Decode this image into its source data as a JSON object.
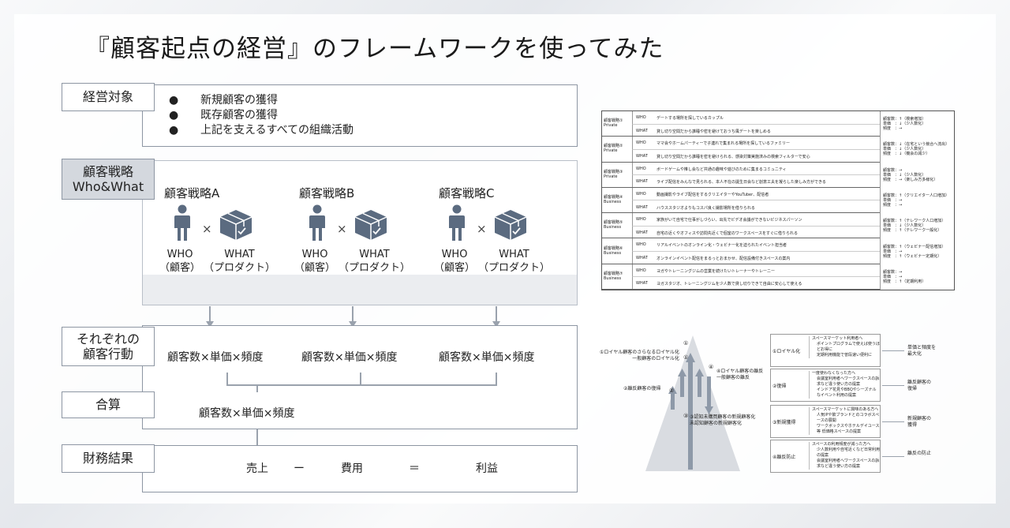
{
  "title": "『顧客起点の経営』のフレームワークを使ってみた",
  "sections": {
    "target": {
      "label": "経営対象",
      "bullets": [
        "新規顧客の獲得",
        "既存顧客の獲得",
        "上記を支えるすべての組織活動"
      ],
      "bullet_char": "●"
    },
    "strategy": {
      "label_line1": "顧客戦略",
      "label_line2": "Who&What",
      "items": [
        {
          "name": "顧客戦略A",
          "times": "×",
          "who": "WHO",
          "who_sub": "（顧客）",
          "what": "WHAT",
          "what_sub": "（プロダクト）"
        },
        {
          "name": "顧客戦略B",
          "times": "×",
          "who": "WHO",
          "who_sub": "（顧客）",
          "what": "WHAT",
          "what_sub": "（プロダクト）"
        },
        {
          "name": "顧客戦略C",
          "times": "×",
          "who": "WHO",
          "who_sub": "（顧客）",
          "what": "WHAT",
          "what_sub": "（プロダクト）"
        }
      ]
    },
    "behavior": {
      "label_line1": "それぞれの",
      "label_line2": "顧客行動",
      "formulas": [
        "顧客数×単価×頻度",
        "顧客数×単価×頻度",
        "顧客数×単価×頻度"
      ]
    },
    "sum": {
      "label": "合算",
      "formula": "顧客数×単価×頻度"
    },
    "finance": {
      "label": "財務結果",
      "sales": "売上",
      "minus": "ー",
      "cost": "費用",
      "equals": "＝",
      "profit": "利益"
    }
  },
  "table": {
    "groups": [
      {
        "name": "顧客戦略①",
        "type": "Private",
        "who": "デートする場所を探しているカップル",
        "what": "貸し切り空間だから誰睡や密を避けておうち風デートを楽しめる",
        "metrics": [
          "顧客数：↑（検索増加）",
          "単価　：↓（少人数化）",
          "頻度　：→"
        ]
      },
      {
        "name": "顧客戦略②",
        "type": "Private",
        "who": "ママ会やホームパーティーで子連れで集まれる場所を探しているファミリー",
        "what": "貸し切り空間だから誰睡を密を避けられる、感染対策実施済みの検索フィルターで安心",
        "metrics": [
          "顧客数：↓（在宅という競合へ流出）",
          "単価　：↓（少人数化）",
          "頻度　：↓（機会の減少）"
        ]
      },
      {
        "name": "顧客戦略③",
        "type": "Private",
        "who": "ボードゲームや推し会など共通の趣味や遊びのために集まるコミュニティ",
        "what": "ライブ配信をみんなで見られる、本人不在の誕生日会など創意工夫を凝らした楽しみ方ができる",
        "metrics": [
          "顧客数：→",
          "単価　：↓（少人数化）",
          "頻度　：→（楽しみ方多様化）"
        ]
      },
      {
        "name": "顧客戦略④",
        "type": "Business",
        "who": "動画撮影やライブ配信をするクリエイターやYouTuber、配信者",
        "what": "ハウススタジオよりもコスパ良く撮影場所を借りられる",
        "metrics": [
          "顧客数：↑（クリエイター人口増加）",
          "単価　：→",
          "頻度　：→"
        ]
      },
      {
        "name": "顧客戦略⑤",
        "type": "Business",
        "who": "家族がいて自宅で仕事がしづらい、出先でビデオ会議ができないビジネスパーソン",
        "what": "自宅の近くやオフィスや訪問先近くで個室のワークスペースをすぐに借りられる",
        "metrics": [
          "顧客数：↑（テレワーク人口増加）",
          "単価　：↓（少人数化）",
          "頻度　：↑（テレワーク一般化）"
        ]
      },
      {
        "name": "顧客戦略⑥",
        "type": "Business",
        "who": "リアルイベントのオンライン化・ウェビナー化を迫られたイベント担当者",
        "what": "オンラインイベント配信をまるっとおまかせ、配信設備付きスペースの案内",
        "metrics": [
          "顧客数：↑（ウェビナー配信増加）",
          "単価　：→",
          "頻度　：↑（ウェビナー定期化）"
        ]
      },
      {
        "name": "顧客戦略⑦",
        "type": "Business",
        "who": "ヨガやトレーニングジムの営業を続けたいトレーナーやトレーニー",
        "what": "ヨガスタジオ、トレーニングジムを少人数で貸し切りできて自由に安心して使える",
        "metrics": [
          "顧客数：→",
          "単価　：→",
          "頻度　：↑（定期利用）"
        ]
      }
    ],
    "who_tag": "WHO",
    "what_tag": "WHAT"
  },
  "diagram": {
    "left_labels": [
      {
        "text": "①ロイヤル顧客のさらなるロイヤル化\n一般顧客のロイヤル化"
      },
      {
        "text": "②離反顧客の復帰"
      },
      {
        "text": "④ロイヤル顧客の離反\n一般顧客の離反"
      },
      {
        "text": "③認知未購買顧客の新規顧客化\n未認知顧客の新規顧客化"
      }
    ],
    "nums": [
      "①",
      "①",
      "④",
      "②",
      "③"
    ],
    "rows": [
      {
        "label": "①ロイヤル化",
        "text": [
          "スペースマーケット利用者へ",
          "ポイントプログラムで使えば使うほどお得に",
          "定期利用機能で曽段速い便利に"
        ],
        "result": "単価と頻度を\n最大化"
      },
      {
        "label": "②復帰",
        "text": [
          "一度使わなくなった方へ",
          "会議室利用者へワークスペースの訴求など違う使い方の提案",
          "インドア花見やBBQやシーズナルなイベント利用の提案"
        ],
        "result": "離反顧客の\n復帰"
      },
      {
        "label": "③新規獲得",
        "text": [
          "スペースマーケットに興味のある方へ",
          "人気IPや飲ブランドとのコラボスペースの展開",
          "ワークボックスやホテルデイユース等 低価格スペースの提案"
        ],
        "result": "新規顧客の\n獲得"
      },
      {
        "label": "④離反防止",
        "text": [
          "スペースの利用頻度が減った方へ",
          "少人数利用や自宅近くなど日常利用の提案",
          "会議室利用者へワークスペースの訴求など違う使い方の提案"
        ],
        "result": "離反の防止"
      }
    ]
  }
}
